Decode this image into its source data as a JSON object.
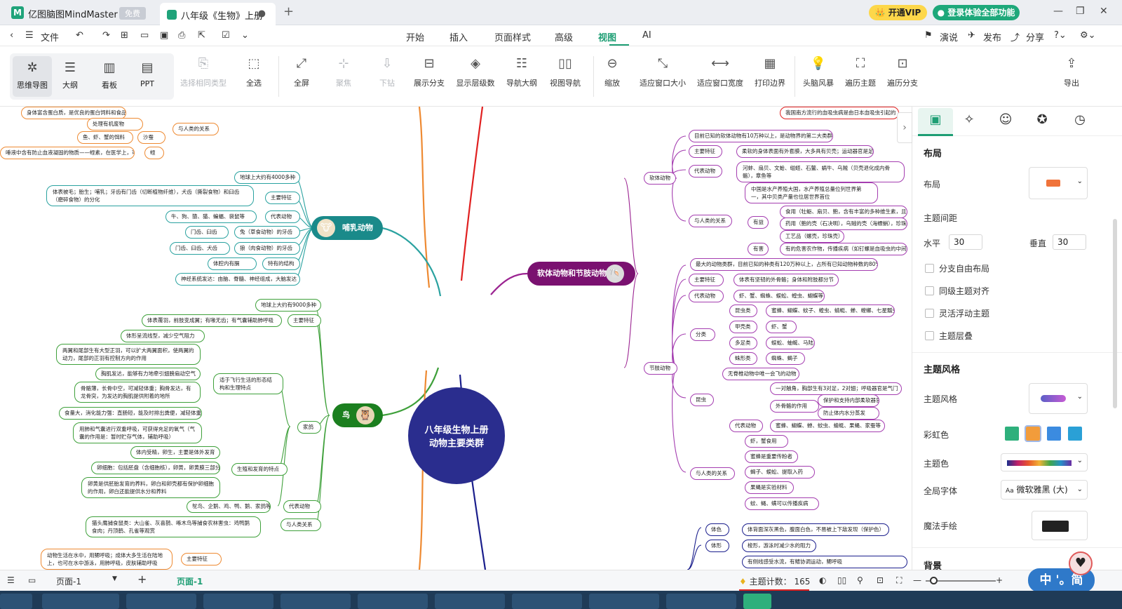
{
  "window": {
    "app_name": "亿图脑图MindMaster",
    "free_badge": "免费",
    "doc_tab": "八年级《生物》上册",
    "vip_label": "开通VIP",
    "login_label": "登录体验全部功能"
  },
  "menu": {
    "file": "文件",
    "items": [
      "开始",
      "插入",
      "页面样式",
      "高级",
      "视图",
      "AI"
    ],
    "active": "视图",
    "right": [
      "演说",
      "发布",
      "分享"
    ]
  },
  "toolbar": {
    "views": [
      "思维导图",
      "大纲",
      "看板",
      "PPT"
    ],
    "tools": [
      "选择相同类型",
      "全选",
      "全屏",
      "聚焦",
      "下钻",
      "展示分支",
      "显示层级数",
      "导航大纲",
      "视图导航",
      "缩放",
      "适应窗口大小",
      "适应窗口宽度",
      "打印边界",
      "头脑风暴",
      "遍历主题",
      "遍历分支"
    ],
    "export": "导出"
  },
  "mindmap": {
    "central": [
      "八年级生物上册",
      "动物主要类群"
    ],
    "branches": {
      "mammal": "哺乳动物",
      "bird": "鸟",
      "mollusk": "软体动物和节肢动物"
    },
    "mammal_nodes": [
      "地球上大约有4000多种",
      "主要特征",
      "体表被毛；胎生；哺乳；牙齿有门齿（切断植物纤维），犬齿（撕裂食物）和臼齿（磨碎食物）的分化",
      "代表动物",
      "牛、狗、猿、猫、蝙蝠、袋鼠等",
      "兔（草食动物）的牙齿",
      "门齿、臼齿",
      "狼（肉食动物）的牙齿",
      "门齿、臼齿、犬齿",
      "特有的结构",
      "体腔内有膈",
      "神经系统发达：由脑、脊髓、神经组成，大脑发达"
    ],
    "bird_nodes": [
      "地球上大约有9000多种",
      "主要特征",
      "体表覆羽，前肢变成翼；有喙无齿；有气囊辅助肺呼吸",
      "体形呈流线型，减少空气阻力",
      "两翼和尾部生有大型正羽，可以扩大两翼面积，使两翼的动力，尾部的正羽有控制方向的作用",
      "胸肌发达，能够有力地牵引翅膀扇动空气",
      "骨骼薄，长骨中空，可减轻体重；胸骨发达，有龙骨突，为发达的胸肌提供附着的地所",
      "食量大，消化能力强：直肠短，能及时排出粪便，减轻体重",
      "用肺和气囊进行双重呼吸，可获得充足的氧气（气囊的作用是：暂时贮存气体，辅助呼吸）",
      "适于飞行生活的形态结构和生理特点",
      "家鸽",
      "体内受精，卵生，主要是体外发育",
      "卵细胞：包括胚盘（含细胞核），卵黄，卵黄膜三部分",
      "卵黄是供胚胎发育的养料，卵白和卵壳都有保护卵细胞的作用，卵白还能提供水分和养料",
      "生殖和发育的特点",
      "鸵鸟、企鹅、鸡、鸭、鹅、家鸽等",
      "代表动物",
      "猫头鹰捕食鼠类：大山雀、灰喜鹊、啄木鸟等捕食农林害虫：鸡鸭鹅食肉；丹顶鹤、孔雀等观赏",
      "与人类关系",
      "主要特征",
      "动物生活在水中，用鳃呼吸；成体大多生活在陆地上，也可在水中游泳，用肺呼吸，皮肤辅助呼吸"
    ],
    "top_left_nodes": [
      "身体富含蛋白质，是优良的蛋白饲料和食品",
      "处理有机废物",
      "鱼、虾、蟹的饵料",
      "沙蚕",
      "蛭",
      "唾液中含有防止血液凝固的物质——蛭素，在医学上，可生产抗血栓药物",
      "与人类的关系"
    ],
    "mollusk_nodes": [
      "目前已知的软体动物有10万种以上，是动物界的第二大类群",
      "软体动物",
      "主要特征",
      "柔软的身体表面有外套膜，大多具有贝壳；运动器官是足",
      "代表动物",
      "河蚌、扇贝、文蛤、缢蛏、石鳖、蜗牛、乌贼（贝壳退化成内骨骼），章鱼等",
      "与人类的关系",
      "中国是水产养殖大国，水产养殖总量位列世界第一，其中贝类产量也位居世界首位",
      "有益",
      "食用（牡蛎、扇贝、鲍，含有丰富的多种维生素，且易消化）",
      "药用（鲍的壳（石决明），乌贼的壳（海螵蛸），珍珠粉）",
      "工艺品（螺壳，珍珠壳）",
      "有害",
      "有的危害农作物，传播疾病（如钉螺是血吸虫的中间宿主）",
      "最大的动物类群，目前已知的种类有120万种以上，占所有已知动物种数的80%",
      "节肢动物",
      "主要特征",
      "体表有坚韧的外骨骼；身体和附肢都分节",
      "代表动物",
      "虾、蟹、蜘蛛、蜈蚣、蝗虫、蝴蝶等",
      "分类",
      "昆虫类",
      "蜜蜂、蝴蝶、蚊子、蝗虫、蜻蜓、蝉、螳螂、七星瓢虫",
      "甲壳类",
      "虾、蟹",
      "多足类",
      "蜈蚣、蚰蜒、马陆",
      "蛛形类",
      "蜘蛛、蝎子",
      "昆虫",
      "无脊椎动物中唯一会飞的动物",
      "一对触角，胸部生有3对足，2对翅；呼吸器官是气门",
      "外骨骼的作用",
      "保护和支持内部柔软器官",
      "防止体内水分蒸发",
      "代表动物",
      "蜜蜂、蝴蝶、蝉、蚊虫、蜻蜓、果蝇、家蚕等",
      "与人类的关系",
      "虾，蟹食用",
      "蜜蜂是重要传粉者",
      "蝎子、蜈蚣、提取入药",
      "果蝇是实验材料",
      "蚊、蝇、螨可以传播疾病",
      "体色",
      "体背面深灰黑色，腹面白色，不易被上下敌发现（保护色）",
      "体形",
      "梭形，游泳时减少水的阻力",
      "有侧线感受水流，有鳍协调运动，鳃呼吸"
    ],
    "top_right_nodes": [
      "我国南方流行的血吸虫病是由日本血吸虫引起的"
    ]
  },
  "panel": {
    "section_layout": "布局",
    "layout_label": "布局",
    "spacing_label": "主题间距",
    "h_label": "水平",
    "h_value": "30",
    "v_label": "垂直",
    "v_value": "30",
    "checks": [
      "分支自由布局",
      "同级主题对齐",
      "灵活浮动主题",
      "主题层叠"
    ],
    "section_style": "主题风格",
    "style_label": "主题风格",
    "rainbow_label": "彩虹色",
    "color_label": "主题色",
    "font_label": "全局字体",
    "font_value": "微软雅黑 (大)",
    "hand_label": "魔法手绘",
    "bg_label": "背景"
  },
  "status": {
    "page_select": "页面-1",
    "page_tab": "页面-1",
    "topic_count_label": "主题计数：",
    "topic_count": "165"
  },
  "ime": "中 '。简",
  "colors": {
    "accent": "#1e9e74",
    "central": "#2a2d8e",
    "mammal": "#1a8a8a",
    "bird": "#1b7f1f",
    "mollusk": "#7a1170",
    "line_mammal": "#2aa2a0",
    "line_bird": "#3ea03a",
    "line_mollusk": "#9b2391",
    "line_mollusk_sub": "#a43db0",
    "line_top": "#ee8a32",
    "line_red": "#e02020",
    "line_navy": "#1a1e8c"
  }
}
